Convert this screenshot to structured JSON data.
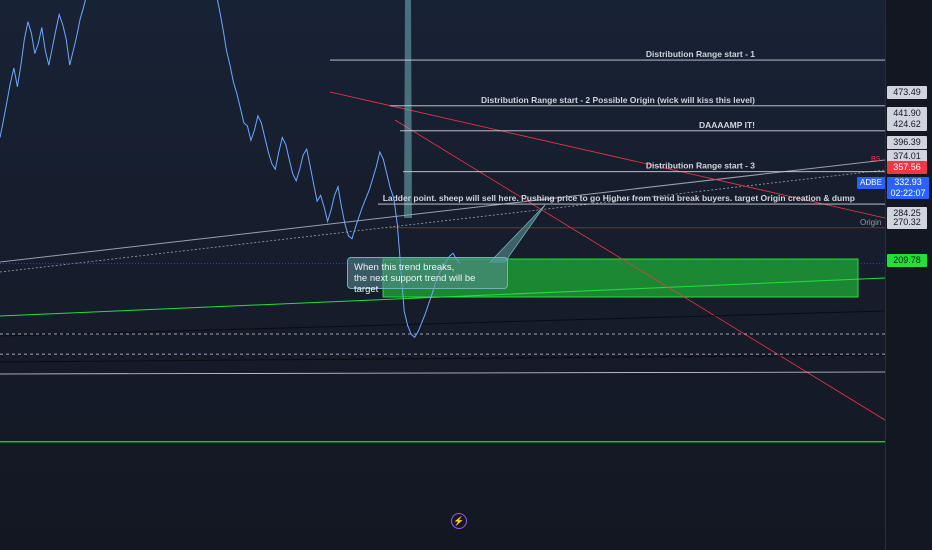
{
  "chart_data": {
    "type": "line",
    "title": "",
    "symbol": "ADBE",
    "ylim": [
      135,
      515
    ],
    "price_series": [
      420,
      432,
      445,
      458,
      468,
      455,
      470,
      488,
      500,
      492,
      478,
      485,
      496,
      480,
      470,
      482,
      494,
      505,
      498,
      488,
      470,
      480,
      490,
      502,
      510,
      520,
      535,
      545,
      552,
      540,
      530,
      548,
      560,
      575,
      590,
      600,
      612,
      605,
      590,
      600,
      620,
      635,
      640,
      628,
      615,
      625,
      640,
      648,
      635,
      620,
      632,
      645,
      650,
      640,
      628,
      615,
      600,
      590,
      575,
      560,
      548,
      535,
      520,
      508,
      495,
      480,
      470,
      458,
      450,
      440,
      430,
      428,
      418,
      425,
      435,
      430,
      420,
      410,
      402,
      398,
      410,
      420,
      415,
      405,
      395,
      390,
      398,
      408,
      412,
      400,
      388,
      376,
      380,
      372,
      362,
      370,
      380,
      386,
      372,
      360,
      352,
      350,
      358,
      365,
      372,
      378,
      384,
      392,
      400,
      410,
      405,
      395,
      385,
      378,
      360,
      330,
      300,
      290,
      284,
      282,
      286,
      292,
      298,
      305,
      312,
      320,
      326,
      330,
      334,
      338,
      340,
      336,
      333
    ],
    "levels": [
      {
        "label": "Distribution Range start - 1",
        "value": "473.49",
        "price": 473.49
      },
      {
        "label": "Distribution Range start - 2 Possible Origin (wick will kiss this level)",
        "value": "441.90",
        "price": 441.9
      },
      {
        "label": "DAAAAMP IT!",
        "value": "424.62",
        "price": 424.62
      },
      {
        "label": "Distribution Range start - 3",
        "value": "396.39",
        "price": 396.39
      },
      {
        "label": "Ladder point. sheep will sell here. Pushing price to go Higher from trend break buyers. target Origin creation & dump",
        "value": "374.01",
        "price": 374.01
      }
    ],
    "red_level": {
      "value": "357.56",
      "price": 357.56,
      "tag": "BS"
    },
    "current_price": {
      "value": "332.93",
      "countdown": "02:22:07",
      "price": 332.93
    },
    "support_levels": [
      {
        "value": "284.25",
        "price": 284.25
      },
      {
        "value": "270.32",
        "price": 270.32,
        "label": "Origin"
      }
    ],
    "target": {
      "value": "209.78",
      "price": 209.78
    },
    "callout": {
      "line1": "When this trend breaks,",
      "line2": "the next support trend will be target"
    }
  },
  "icons": {
    "bottom": "lightning-icon"
  },
  "colors": {
    "green": "#22e03a",
    "red": "#f23645",
    "blue": "#2962ff",
    "price_line": "#6fa8ff"
  }
}
